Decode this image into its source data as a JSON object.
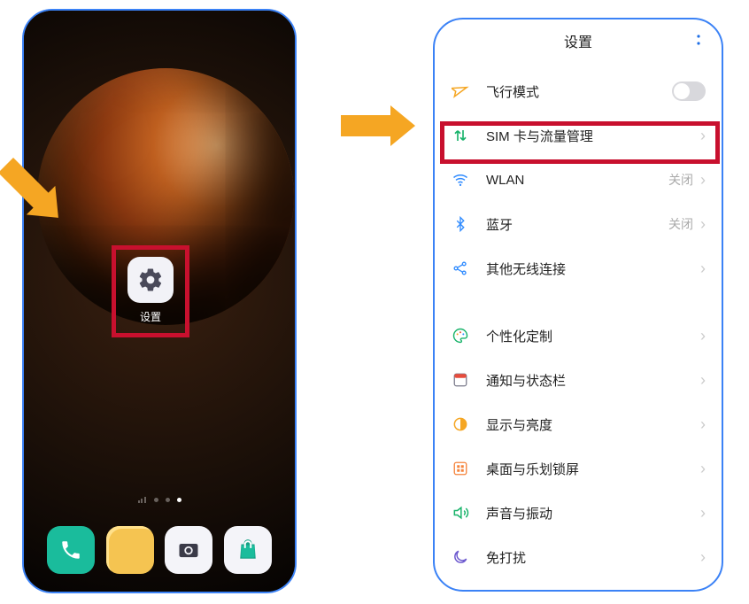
{
  "homescreen": {
    "settings_label": "设置"
  },
  "settings_screen": {
    "header_title": "设置",
    "items": {
      "airplane": {
        "label": "飞行模式"
      },
      "sim": {
        "label": "SIM 卡与流量管理"
      },
      "wlan": {
        "label": "WLAN",
        "value": "关闭"
      },
      "bt": {
        "label": "蓝牙",
        "value": "关闭"
      },
      "other": {
        "label": "其他无线连接"
      },
      "theme": {
        "label": "个性化定制"
      },
      "notif": {
        "label": "通知与状态栏"
      },
      "display": {
        "label": "显示与亮度"
      },
      "desktop": {
        "label": "桌面与乐划锁屏"
      },
      "sound": {
        "label": "声音与振动"
      },
      "dnd": {
        "label": "免打扰"
      }
    }
  },
  "colors": {
    "highlight_red": "#c8102e",
    "arrow_orange": "#f5a623",
    "phone_border": "#3b82f6"
  }
}
